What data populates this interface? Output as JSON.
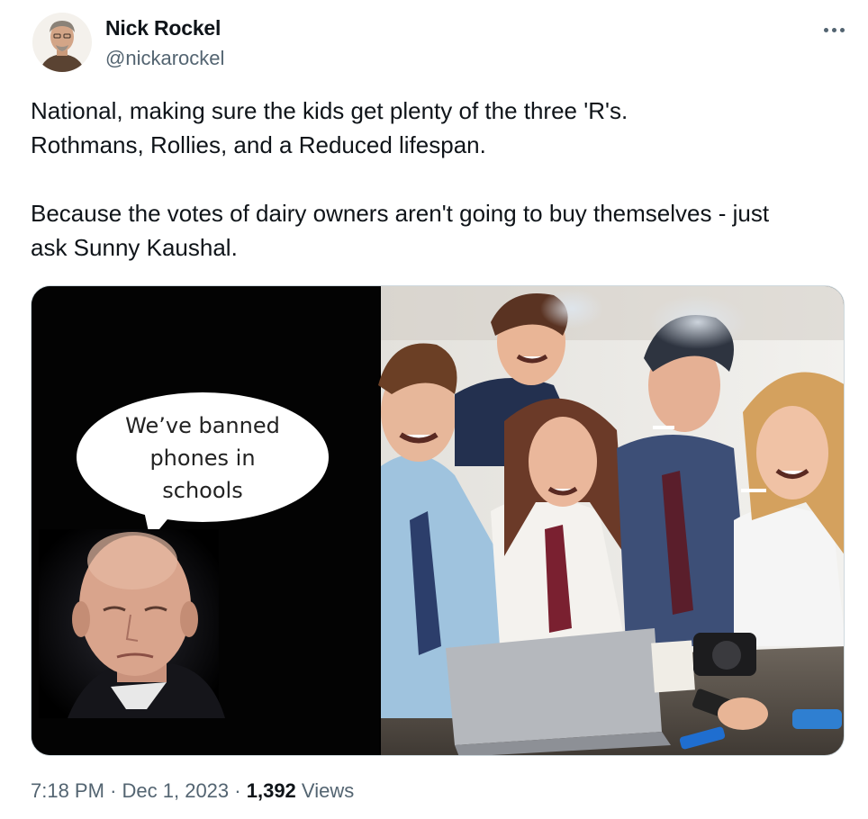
{
  "author": {
    "name": "Nick Rockel",
    "handle": "@nickarockel"
  },
  "tweet": {
    "lines": [
      "National, making sure the kids get plenty of the three 'R's.",
      "Rothmans, Rollies, and a Reduced lifespan.",
      "Because the votes of dairy owners aren't going to buy themselves - just",
      "ask Sunny Kaushal."
    ]
  },
  "media": {
    "speech_bubble": [
      "We’ve banned",
      "phones in",
      "schools"
    ]
  },
  "meta": {
    "time": "7:18 PM",
    "separator": "·",
    "date": "Dec 1, 2023",
    "views_count": "1,392",
    "views_label": "Views"
  },
  "icons": {
    "more": "more-horizontal-icon"
  }
}
